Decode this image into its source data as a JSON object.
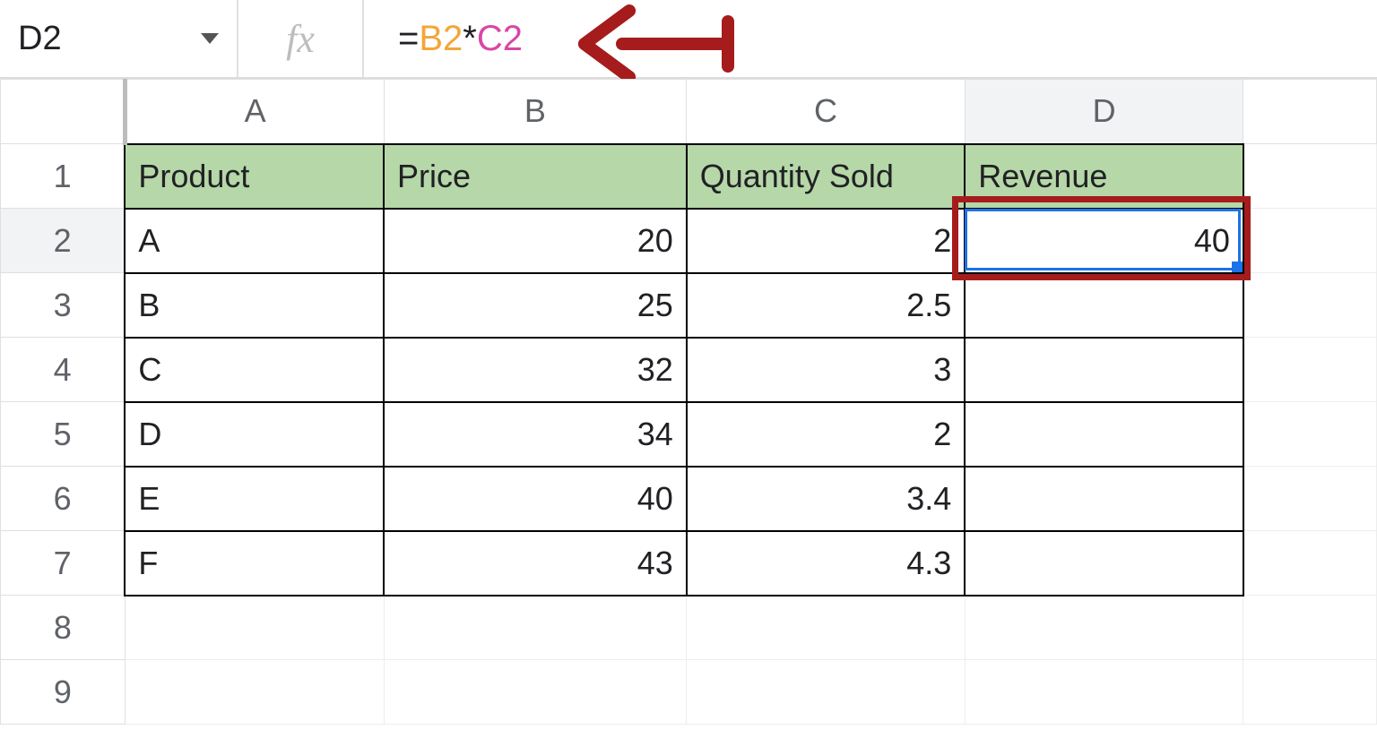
{
  "formula_bar": {
    "cell_ref": "D2",
    "fx_label": "fx",
    "eq": "=",
    "ref1": "B2",
    "op": "*",
    "ref2": "C2"
  },
  "col_headers": [
    "A",
    "B",
    "C",
    "D"
  ],
  "row_headers": [
    "1",
    "2",
    "3",
    "4",
    "5",
    "6",
    "7",
    "8",
    "9"
  ],
  "selected_cell": "D2",
  "table": {
    "headers": [
      "Product",
      "Price",
      "Quantity Sold",
      "Revenue"
    ],
    "rows": [
      {
        "product": "A",
        "price": "20",
        "qty": "2",
        "rev": "40"
      },
      {
        "product": "B",
        "price": "25",
        "qty": "2.5",
        "rev": ""
      },
      {
        "product": "C",
        "price": "32",
        "qty": "3",
        "rev": ""
      },
      {
        "product": "D",
        "price": "34",
        "qty": "2",
        "rev": ""
      },
      {
        "product": "E",
        "price": "40",
        "qty": "3.4",
        "rev": ""
      },
      {
        "product": "F",
        "price": "43",
        "qty": "4.3",
        "rev": ""
      }
    ]
  },
  "annotations": {
    "arrow_color": "#a61c1c",
    "box_color": "#a61c1c"
  }
}
